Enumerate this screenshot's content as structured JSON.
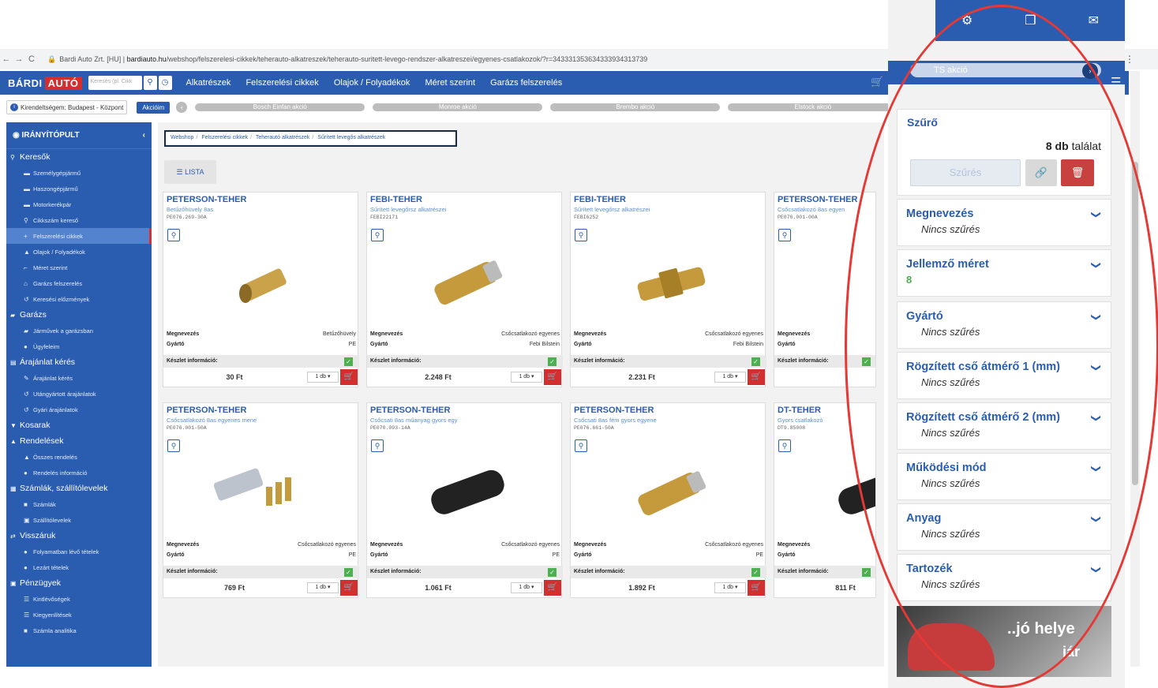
{
  "browser": {
    "site": "Bardi Auto Zrt. [HU]",
    "host": "bardiauto.hu",
    "path": "/webshop/felszerelesi-cikkek/teherauto-alkatreszek/teherauto-suritett-levego-rendszer-alkatreszei/egyenes-csatlakozok/?r=34333135363433393431373​9"
  },
  "header": {
    "logo_part1": "BÁRDI",
    "logo_part2": "AUTÓ",
    "search_placeholder": "Keresés (pl. Cikk",
    "menu": [
      "Alkatrészek",
      "Felszerelési cikkek",
      "Olajok / Folyadékok",
      "Méret szerint",
      "Garázs felszerelés"
    ]
  },
  "subbar": {
    "branch": "Kirendeltségem: Budapest - Központ",
    "akciok_label": "Akcióim",
    "promos": [
      "Bosch Einfan akció",
      "Monroe akció",
      "Brembo akció",
      "Elstock akció"
    ]
  },
  "sidebar": {
    "title": "IRÁNYÍTÓPULT",
    "groups": [
      {
        "label": "Keresők",
        "items": [
          "Személygépjármű",
          "Haszongépjármű",
          "Motorkerékpár",
          "Cikkszám kereső",
          "Felszerelési cikkek",
          "Olajok / Folyadékok",
          "Méret szerint",
          "Garázs felszerelés",
          "Keresési előzmények"
        ]
      },
      {
        "label": "Garázs",
        "items": [
          "Járművek a garázsban",
          "Ügyfeleim"
        ]
      },
      {
        "label": "Árajánlat kérés",
        "items": [
          "Árajánlat kérés",
          "Utángyártott árajánlatok",
          "Gyári árajánlatok"
        ]
      },
      {
        "label": "Kosarak",
        "items": []
      },
      {
        "label": "Rendelések",
        "items": [
          "Összes rendelés",
          "Rendelés információ"
        ]
      },
      {
        "label": "Számlák, szállítólevelek",
        "items": [
          "Számlák",
          "Szállítólevelek"
        ]
      },
      {
        "label": "Visszáruk",
        "items": [
          "Folyamatban lévő tételek",
          "Lezárt tételek"
        ]
      },
      {
        "label": "Pénzügyek",
        "items": [
          "Kintlévőségek",
          "Kiegyenlítések",
          "Számla analitika"
        ]
      }
    ]
  },
  "breadcrumb": [
    "Webshop",
    "Felszerelési cikkek",
    "Teherautó alkatrészek",
    "Sűrített levegős alkatrészek"
  ],
  "list_button": "LISTA",
  "labels": {
    "name": "Megnevezés",
    "maker": "Gyártó",
    "stock": "Készlet információ:",
    "qty": "1 db"
  },
  "products": [
    {
      "brand": "PETERSON-TEHER",
      "desc": "Betűzőhüvely 8as",
      "code": "PE076.269-30A",
      "name": "Betűzőhüvely",
      "maker": "PE",
      "price": "30 Ft"
    },
    {
      "brand": "FEBI-TEHER",
      "desc": "Sűrített levegőrsz alkatrészei",
      "code": "FEBI22171",
      "name": "Csőcsatlakozó egyenes",
      "maker": "Febi Bilstein",
      "price": "2.248 Ft"
    },
    {
      "brand": "FEBI-TEHER",
      "desc": "Sűrített levegőrsz alkatrészei",
      "code": "FEBI6252",
      "name": "Csőcsatlakozó egyenes",
      "maker": "Febi Bilstein",
      "price": "2.231 Ft"
    },
    {
      "brand": "PETERSON-TEHER",
      "desc": "Csőcsatlakozó 8as egyen",
      "code": "PE076.001-00A",
      "name": "",
      "maker": "",
      "price": ""
    },
    {
      "brand": "PETERSON-TEHER",
      "desc": "Csőcsatlakozó 8as egyenes mene",
      "code": "PE076.001-50A",
      "name": "Csőcsatlakozó egyenes",
      "maker": "PE",
      "price": "769 Ft"
    },
    {
      "brand": "PETERSON-TEHER",
      "desc": "Csőcsati 8as műanyag gyors egy",
      "code": "PE070.093-14A",
      "name": "Csőcsatlakozó egyenes",
      "maker": "PE",
      "price": "1.061 Ft"
    },
    {
      "brand": "PETERSON-TEHER",
      "desc": "Csőcsati 8as fém gyors egyene",
      "code": "PE076.661-50A",
      "name": "Csőcsatlakozó egyenes",
      "maker": "PE",
      "price": "1.892 Ft"
    },
    {
      "brand": "DT-TEHER",
      "desc": "Gyors csatlakozó",
      "code": "DT9.85008",
      "name": "nes",
      "maker": "PE",
      "price": "811 Ft"
    }
  ],
  "panel": {
    "search_text": "TS akció",
    "filter_title": "Szűrő",
    "count": "8 db",
    "count_suffix": "találat",
    "filter_button": "Szűrés",
    "sections": [
      {
        "title": "Megnevezés",
        "value": "Nincs szűrés"
      },
      {
        "title": "Jellemző méret",
        "value": "8"
      },
      {
        "title": "Gyártó",
        "value": "Nincs szűrés"
      },
      {
        "title": "Rögzített cső átmérő 1 (mm)",
        "value": "Nincs szűrés"
      },
      {
        "title": "Rögzített cső átmérő 2 (mm)",
        "value": "Nincs szűrés"
      },
      {
        "title": "Működési mód",
        "value": "Nincs szűrés"
      },
      {
        "title": "Anyag",
        "value": "Nincs szűrés"
      },
      {
        "title": "Tartozék",
        "value": "Nincs szűrés"
      }
    ],
    "banner_line1": "..jó helye",
    "banner_line2": "jár"
  },
  "colors": {
    "primary": "#2a5db0",
    "accent_red": "#d32f2f",
    "stock_ok": "#4caf50"
  }
}
